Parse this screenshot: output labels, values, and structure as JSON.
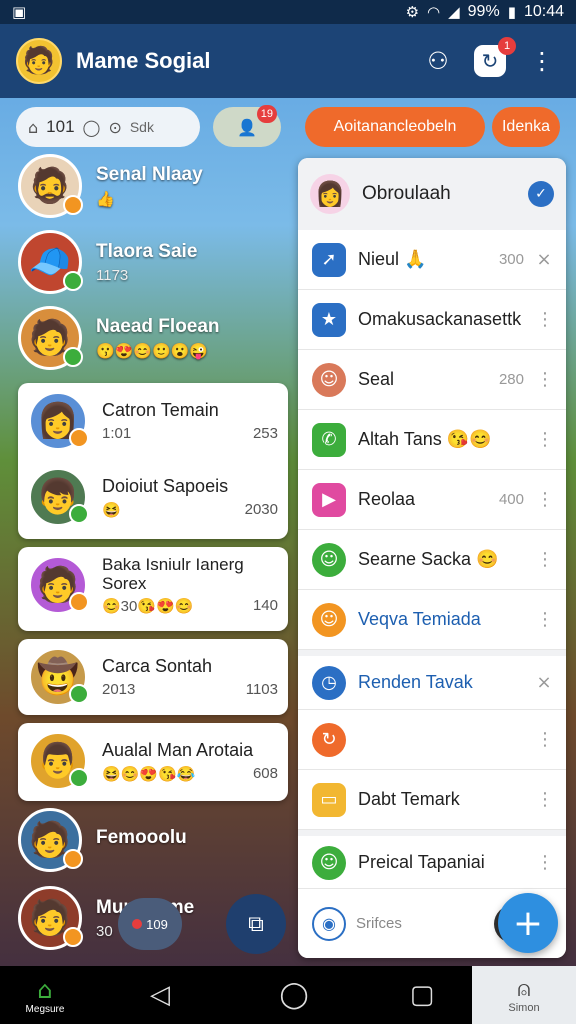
{
  "status_bar": {
    "time": "10:44",
    "battery": "99%"
  },
  "header": {
    "title": "Mame Sogial",
    "notif_badge": "1"
  },
  "filters": {
    "count": "101",
    "chip_text": "Sdk",
    "chip2_badge": "19"
  },
  "action_buttons": {
    "primary": "Aoitanancleobeln",
    "secondary": "Idenka"
  },
  "chats": [
    {
      "name": "Senal Nlaay",
      "sub": "👍",
      "status": "orange"
    },
    {
      "name": "Tlaora Saie",
      "sub": "1173",
      "status": "green"
    },
    {
      "name": "Naead Floean",
      "sub": "😗😍😊🙂😮😜",
      "status": "green"
    }
  ],
  "cards": [
    [
      {
        "name": "Catron Temain",
        "sub_left": "1:01",
        "sub_right": "253",
        "status": "orange"
      },
      {
        "name": "Doioiut Sapoeis",
        "sub_left": "😆",
        "sub_right": "2030",
        "status": "green"
      }
    ],
    [
      {
        "name": "Baka Isniulr Ianerg Sorex",
        "sub_left": "😊30😘😍😊",
        "sub_right": "140",
        "status": "orange"
      }
    ],
    [
      {
        "name": "Carca Sontah",
        "sub_left": "2013",
        "sub_right": "1103",
        "status": "green"
      }
    ],
    [
      {
        "name": "Aualal Man Arotaia",
        "sub_left": "😆😊😍😘😂",
        "sub_right": "608",
        "status": "green"
      }
    ]
  ],
  "chats_bottom": [
    {
      "name": "Femooolu",
      "sub": "",
      "status": "orange"
    },
    {
      "name": "Munceame",
      "sub": "30",
      "status": "orange"
    }
  ],
  "float_pill_value": "109",
  "panel": {
    "header_name": "Obroulaah",
    "rows": [
      {
        "label": "Nieul 🙏",
        "num": "300",
        "action": "×",
        "icon": "pin-icon",
        "color": "#2b6fc4",
        "blue": false
      },
      {
        "label": "Omakusackanasettk",
        "num": "",
        "action": "⋮",
        "icon": "star-icon",
        "color": "#2b6fc4",
        "blue": false
      },
      {
        "label": "Seal",
        "num": "280",
        "action": "⋮",
        "icon": "avatar-icon",
        "color": "#d9795a",
        "blue": false
      },
      {
        "label": "Altah Tans 😘😊",
        "num": "",
        "action": "⋮",
        "icon": "phone-icon",
        "color": "#3cad3c",
        "blue": false
      },
      {
        "label": "Reolaa",
        "num": "400",
        "action": "⋮",
        "icon": "play-icon",
        "color": "#e04aa0",
        "blue": false
      },
      {
        "label": "Searne Sacka 😊",
        "num": "",
        "action": "⋮",
        "icon": "avatar-icon",
        "color": "#3cad3c",
        "blue": false
      },
      {
        "label": "Veqva Temiada",
        "num": "",
        "action": "⋮",
        "icon": "avatar-icon",
        "color": "#f29521",
        "blue": true
      },
      {
        "label": "Renden Tavak",
        "num": "",
        "action": "×",
        "icon": "clock-icon",
        "color": "#2b6fc4",
        "blue": true
      },
      {
        "label": "",
        "num": "",
        "action": "⋮",
        "icon": "refresh-icon",
        "color": "#ef6a2b",
        "blue": false
      },
      {
        "label": "Dabt Temark",
        "num": "",
        "action": "⋮",
        "icon": "folder-icon",
        "color": "#f2b731",
        "blue": false
      },
      {
        "label": "Preical Tapaniai",
        "num": "",
        "action": "⋮",
        "icon": "avatar-icon",
        "color": "#3cad3c",
        "blue": false
      }
    ],
    "footer_label": "Srifces"
  },
  "nav": {
    "home_label": "Megsure",
    "right_label": "Simon"
  }
}
